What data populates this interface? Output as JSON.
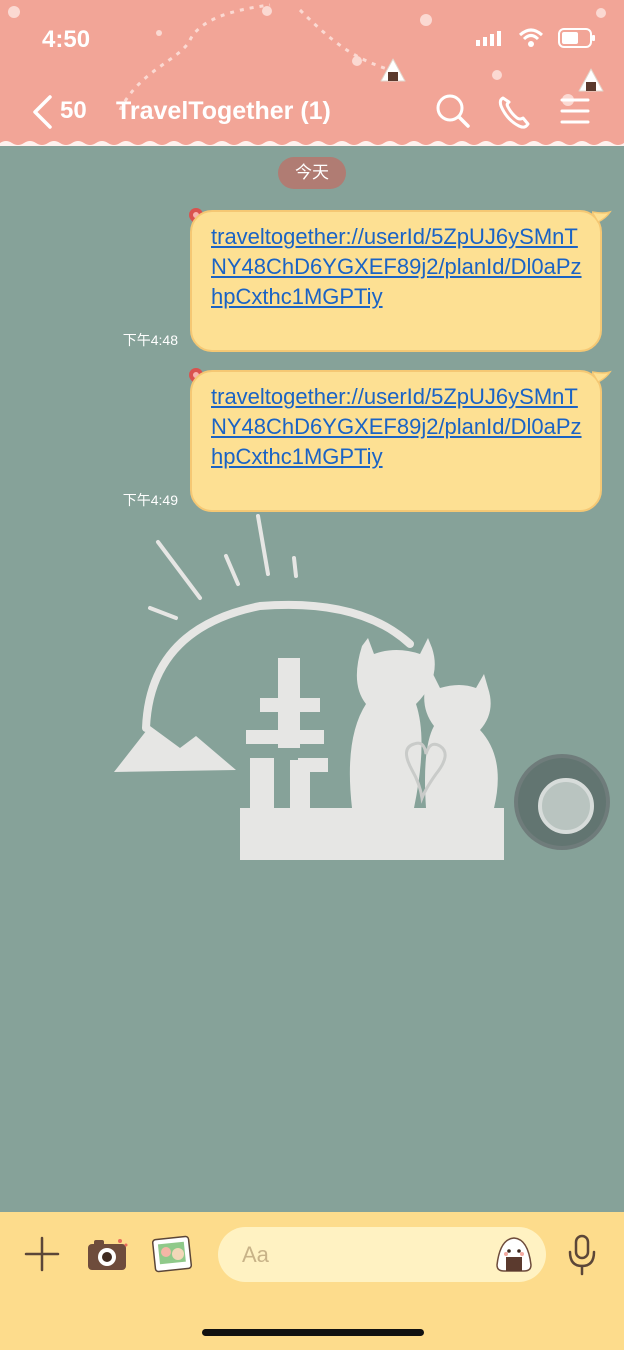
{
  "status": {
    "time": "4:50"
  },
  "header": {
    "back_count": "50",
    "title": "TravelTogether (1)"
  },
  "date_chip": "今天",
  "messages": [
    {
      "link": "traveltogether://userId/5ZpUJ6ySMnTNY48ChD6YGXEF89j2/planId/Dl0aPzhpCxthc1MGPTiy",
      "time": "下午4:48"
    },
    {
      "link": "traveltogether://userId/5ZpUJ6ySMnTNY48ChD6YGXEF89j2/planId/Dl0aPzhpCxthc1MGPTiy",
      "time": "下午4:49"
    }
  ],
  "input": {
    "placeholder": "Aa"
  },
  "colors": {
    "header": "#f2a597",
    "background": "#86a299",
    "bubble": "#fde093",
    "link": "#1a63c5",
    "input_bar": "#fddc8c"
  },
  "icons": [
    "back-icon",
    "search-icon",
    "phone-icon",
    "menu-icon",
    "plus-icon",
    "camera-icon",
    "image-icon",
    "emoji-icon",
    "mic-icon"
  ]
}
